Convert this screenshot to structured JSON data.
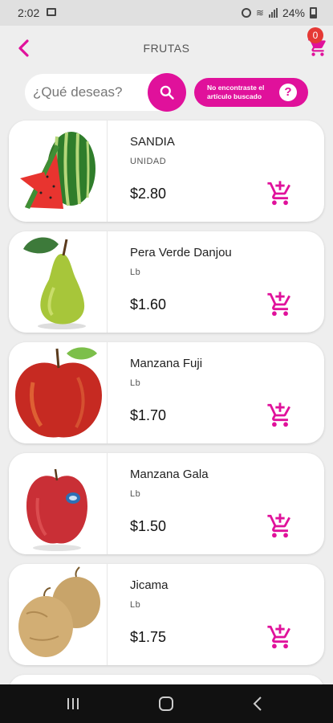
{
  "status": {
    "time": "2:02",
    "battery": "24%"
  },
  "header": {
    "title": "FRUTAS",
    "cart_count": "0"
  },
  "search": {
    "placeholder": "¿Qué deseas?"
  },
  "help": {
    "label": "No encontraste el artículo buscado",
    "icon": "?"
  },
  "products": [
    {
      "name": "SANDIA",
      "unit": "UNIDAD",
      "price": "$2.80",
      "image": "watermelon"
    },
    {
      "name": "Pera Verde Danjou",
      "unit": "Lb",
      "price": "$1.60",
      "image": "green-pear"
    },
    {
      "name": "Manzana Fuji",
      "unit": "Lb",
      "price": "$1.70",
      "image": "fuji-apple"
    },
    {
      "name": "Manzana Gala",
      "unit": "Lb",
      "price": "$1.50",
      "image": "gala-apple"
    },
    {
      "name": "Jicama",
      "unit": "Lb",
      "price": "$1.75",
      "image": "jicama"
    }
  ],
  "colors": {
    "accent": "#e0119b",
    "badge": "#e53935",
    "background": "#eeeeee"
  },
  "icons": {
    "back": "chevron-left-icon",
    "cart": "cart-icon",
    "search": "search-icon",
    "add_to_cart": "cart-plus-icon"
  }
}
